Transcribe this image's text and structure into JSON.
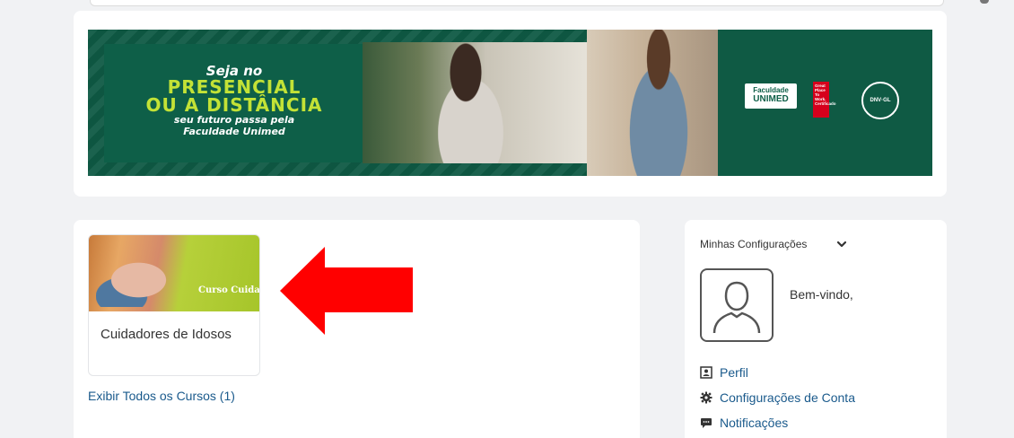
{
  "banner": {
    "slogan_line1": "Seja no",
    "slogan_line2": "PRESENCIAL",
    "slogan_line3": "OU A DISTÂNCIA",
    "slogan_line4": "seu futuro passa pela",
    "slogan_line5": "Faculdade Unimed",
    "logo_faculdade_top": "Faculdade",
    "logo_faculdade_bottom": "UNIMED",
    "logo_gptw": "Great Place To Work. Certificado",
    "logo_dnv": "DNV·GL"
  },
  "courses": {
    "items": [
      {
        "image_label": "Curso Cuidad",
        "name": "Cuidadores de Idosos"
      }
    ],
    "view_all_label": "Exibir Todos os Cursos (1)"
  },
  "annotation": {
    "arrow_color": "#ff0000"
  },
  "settings": {
    "title": "Minhas Configurações",
    "welcome": "Bem-vindo,",
    "links": [
      {
        "icon": "profile-icon",
        "label": "Perfil"
      },
      {
        "icon": "gear-icon",
        "label": "Configurações de Conta"
      },
      {
        "icon": "message-icon",
        "label": "Notificações"
      }
    ]
  },
  "colors": {
    "link": "#1a5a8c",
    "banner_green": "#0f5a44",
    "banner_accent": "#c3e236"
  }
}
